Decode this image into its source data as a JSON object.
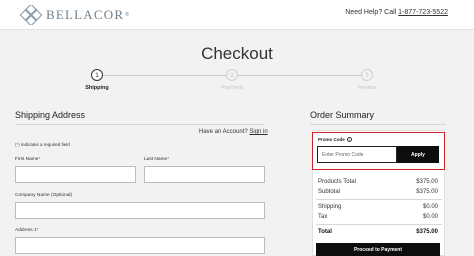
{
  "header": {
    "logo_text": "BELLACOR",
    "logo_tm": "®",
    "help_label": "Need Help? Call ",
    "help_phone": "1-877-723-5522"
  },
  "page": {
    "title": "Checkout"
  },
  "steps": [
    {
      "number": "1",
      "label": "Shipping",
      "state": "active"
    },
    {
      "number": "2",
      "label": "Payment",
      "state": "inactive"
    },
    {
      "number": "3",
      "label": "Review",
      "state": "inactive"
    }
  ],
  "shipping": {
    "title": "Shipping Address",
    "account_prompt": "Have an Account? ",
    "signin_label": "Sign in",
    "required_star": "(*)",
    "required_note": " indicates a required field",
    "fields": {
      "first_name": {
        "label": "First Name",
        "required": "*",
        "value": ""
      },
      "last_name": {
        "label": "Last Name",
        "required": "*",
        "value": ""
      },
      "company": {
        "label": "Company Name (Optional)",
        "value": ""
      },
      "address1": {
        "label": "Address 1",
        "required": "*",
        "value": ""
      }
    }
  },
  "summary": {
    "title": "Order Summary",
    "promo": {
      "label": "Promo Code",
      "info_icon": "i",
      "placeholder": "Enter Promo Code",
      "value": "",
      "apply_label": "Apply"
    },
    "rows": {
      "products_total": {
        "label": "Products Total",
        "value": "$375.00"
      },
      "subtotal": {
        "label": "Subtotal",
        "value": "$375.00"
      },
      "shipping": {
        "label": "Shipping",
        "value": "$0.00"
      },
      "tax": {
        "label": "Tax",
        "value": "$0.00"
      },
      "total": {
        "label": "Total",
        "value": "$375.00"
      }
    },
    "proceed_label": "Proceed to Payment"
  },
  "colors": {
    "accent_red": "#d0242b",
    "button_black": "#0d0d0d",
    "logo_slate": "#6f7f8c"
  }
}
